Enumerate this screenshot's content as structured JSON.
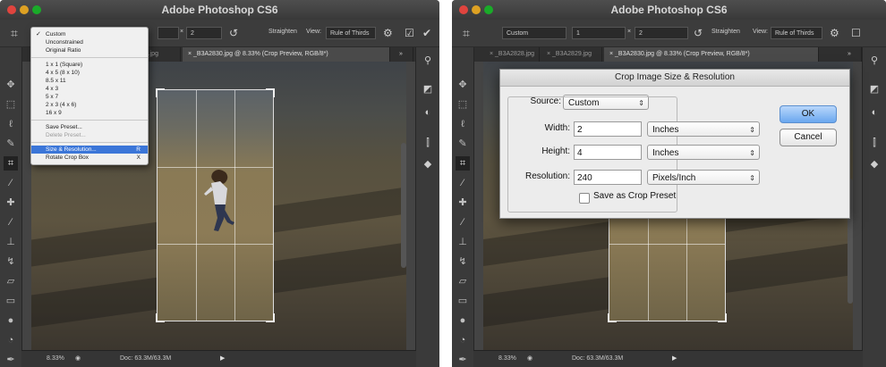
{
  "left": {
    "app_title": "Adobe Photoshop CS6",
    "options_bar": {
      "width_value": "",
      "height_value": "2",
      "straighten_label": "Straighten",
      "view_label": "View:",
      "view_value": "Rule of Thirds"
    },
    "tabs": [
      {
        "label": "829.jpg"
      },
      {
        "label": "× _B3A2830.jpg @ 8.33% (Crop Preview, RGB/8*)"
      }
    ],
    "menu": {
      "items": [
        {
          "label": "Custom",
          "checked": true
        },
        {
          "label": "Unconstrained"
        },
        {
          "label": "Original Ratio"
        },
        {
          "label": "1 x 1 (Square)"
        },
        {
          "label": "4 x 5 (8 x 10)"
        },
        {
          "label": "8.5 x 11"
        },
        {
          "label": "4 x 3"
        },
        {
          "label": "5 x 7"
        },
        {
          "label": "2 x 3 (4 x 6)"
        },
        {
          "label": "16 x 9"
        },
        {
          "label": "Save Preset..."
        },
        {
          "label": "Delete Preset..."
        },
        {
          "label": "Size & Resolution...",
          "shortcut": "R"
        },
        {
          "label": "Rotate Crop Box",
          "shortcut": "X"
        }
      ]
    },
    "status": {
      "zoom": "8.33%",
      "doc": "Doc: 63.3M/63.3M"
    }
  },
  "right": {
    "app_title": "Adobe Photoshop CS6",
    "options_bar": {
      "preset_value": "Custom",
      "width_value": "1",
      "height_value": "2",
      "straighten_label": "Straighten",
      "view_label": "View:",
      "view_value": "Rule of Thirds"
    },
    "tabs": [
      {
        "label": "× _B3A2828.jpg"
      },
      {
        "label": "× _B3A2829.jpg"
      },
      {
        "label": "× _B3A2830.jpg @ 8.33% (Crop Preview, RGB/8*)"
      }
    ],
    "dialog": {
      "title": "Crop Image Size & Resolution",
      "source_label": "Source:",
      "source_value": "Custom",
      "width_label": "Width:",
      "width_value": "2",
      "width_unit": "Inches",
      "height_label": "Height:",
      "height_value": "4",
      "height_unit": "Inches",
      "resolution_label": "Resolution:",
      "resolution_value": "240",
      "resolution_unit": "Pixels/Inch",
      "save_preset_label": "Save as Crop Preset",
      "ok_label": "OK",
      "cancel_label": "Cancel"
    },
    "status": {
      "zoom": "8.33%",
      "doc": "Doc: 63.3M/63.3M"
    }
  }
}
